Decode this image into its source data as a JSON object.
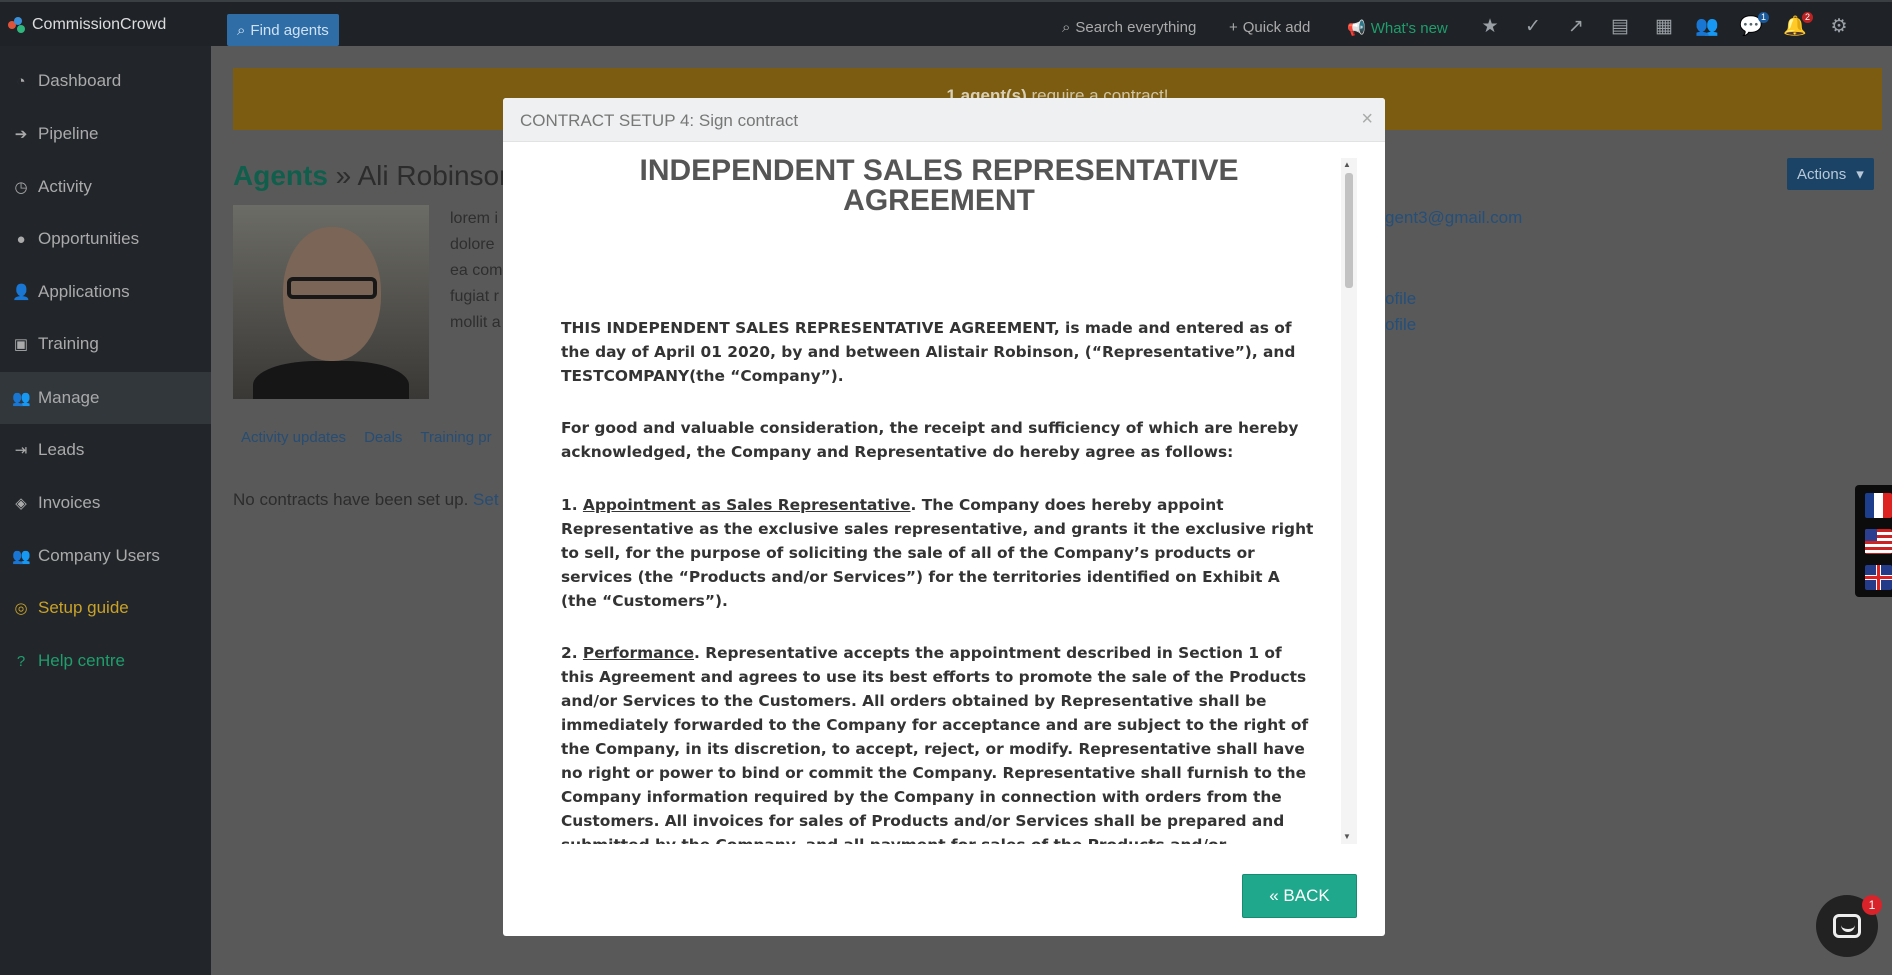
{
  "app": {
    "name": "CommissionCrowd"
  },
  "topbar": {
    "find_agents": "Find agents",
    "search": "Search everything",
    "quick_add": "Quick add",
    "whats_new": "What's new",
    "messages_badge": "1",
    "notifications_badge": "2"
  },
  "sidebar": {
    "items": [
      {
        "label": "Dashboard",
        "icon": "dashboard-icon"
      },
      {
        "label": "Pipeline",
        "icon": "arrow-right-icon"
      },
      {
        "label": "Activity",
        "icon": "clock-icon"
      },
      {
        "label": "Opportunities",
        "icon": "money-bag-icon"
      },
      {
        "label": "Applications",
        "icon": "user-icon"
      },
      {
        "label": "Training",
        "icon": "book-icon"
      },
      {
        "label": "Manage",
        "icon": "users-icon"
      },
      {
        "label": "Leads",
        "icon": "sign-in-icon"
      },
      {
        "label": "Invoices",
        "icon": "tag-icon"
      },
      {
        "label": "Company Users",
        "icon": "users-icon"
      },
      {
        "label": "Setup guide",
        "icon": "compass-icon"
      },
      {
        "label": "Help centre",
        "icon": "question-icon"
      }
    ]
  },
  "main": {
    "banner_count": "1 agent(s)",
    "banner_text": " require a contract!",
    "breadcrumb_root": "Agents",
    "breadcrumb_sep": " » ",
    "agent_name": "Ali Robinson",
    "bio_lines": [
      "lorem i",
      "dolore",
      "ea com",
      "fugiat r",
      "mollit a"
    ],
    "email": "gent3@gmail.com",
    "profile_link_1": "ofile",
    "profile_link_2": "ofile",
    "tabs": [
      "Activity updates",
      "Deals",
      "Training pr"
    ],
    "no_contract_text": "No contracts have been set up. ",
    "no_contract_link": "Set c",
    "actions": "Actions"
  },
  "modal": {
    "title": "CONTRACT SETUP 4: Sign contract",
    "close": "×",
    "doc_title": "INDEPENDENT SALES REPRESENTATIVE AGREEMENT",
    "para_intro": "THIS INDEPENDENT SALES REPRESENTATIVE AGREEMENT, is made and entered as of the day of April 01 2020, by and between Alistair Robinson, (“Representative”), and TESTCOMPANY(the “Company”).",
    "para_consideration": "For good and valuable consideration, the receipt and sufficiency of which are hereby acknowledged, the Company and Representative do hereby agree as follows:",
    "s1_num": "1. ",
    "s1_heading": "Appointment as Sales Representative",
    "s1_text": ". The Company does hereby appoint Representative as the exclusive sales representative, and grants it the exclusive right to sell, for the purpose of soliciting the sale of all of the Company’s products or services (the “Products and/or Services”) for the territories identified on Exhibit A (the “Customers”).",
    "s2_num": "2. ",
    "s2_heading": "Performance",
    "s2_text": ". Representative accepts the appointment described in Section 1 of this Agreement and agrees to use its best efforts to promote the sale of the Products and/or Services to the Customers. All orders obtained by Representative shall be immediately forwarded to the Company for acceptance and are subject to the right of the Company, in its discretion, to accept, reject, or modify. Representative shall have no right or power to bind or commit the Company. Representative shall furnish to the Company information required by the Company in connection with orders from the Customers. All invoices for sales of Products and/or Services shall be prepared and submitted by the Company, and all payment for sales of the Products and/or",
    "back_button": "« BACK"
  },
  "chat": {
    "badge": "1"
  },
  "colors": {
    "accent_green": "#1fa88c",
    "banner": "#f2a826",
    "link_blue": "#2a6fb0",
    "sidebar": "#22262a"
  }
}
